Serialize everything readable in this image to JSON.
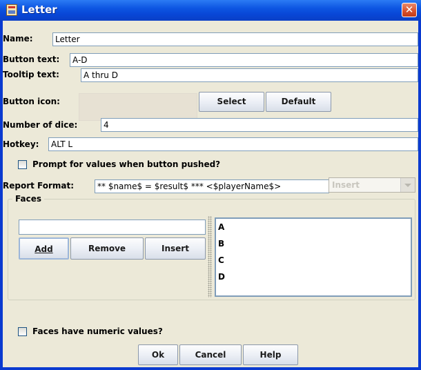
{
  "window": {
    "title": "Letter",
    "close_glyph": "✕"
  },
  "form": {
    "name_label": "Name:",
    "name_value": "Letter",
    "button_text_label": "Button text:",
    "button_text_value": "A-D",
    "tooltip_label": "Tooltip text:",
    "tooltip_value": "A thru D",
    "icon_label": "Button icon:",
    "select_label": "Select",
    "default_label": "Default",
    "dice_label": "Number of dice:",
    "dice_value": "4",
    "hotkey_label": "Hotkey:",
    "hotkey_value": "ALT L",
    "prompt_label": "Prompt for values when button pushed?",
    "prompt_checked": false,
    "report_label": "Report Format:",
    "report_value": "** $name$ = $result$ *** <$playerName$>",
    "insert_combo_label": "Insert"
  },
  "faces": {
    "group_label": "Faces",
    "input_value": "",
    "add_label": "Add",
    "remove_label": "Remove",
    "insert_label": "Insert",
    "items": [
      "A",
      "B",
      "C",
      "D"
    ]
  },
  "numeric_label": "Faces have numeric values?",
  "numeric_checked": false,
  "footer": {
    "ok_label": "Ok",
    "cancel_label": "Cancel",
    "help_label": "Help"
  },
  "colors": {
    "titlebar": "#0a3ad0",
    "dialog_bg": "#ece9d8",
    "close_button": "#d8502c",
    "field_border": "#7f9db9"
  },
  "icons": {
    "window_icon": "app-icon",
    "close": "close-icon",
    "dropdown": "chevron-down-icon"
  }
}
